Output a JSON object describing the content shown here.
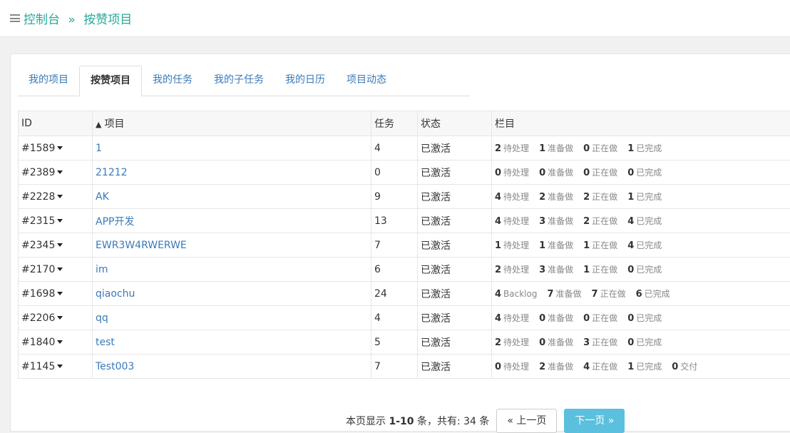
{
  "breadcrumb": {
    "home": "控制台",
    "separator": "»",
    "current": "按赞项目"
  },
  "tabs": [
    {
      "label": "我的项目",
      "active": false
    },
    {
      "label": "按赞项目",
      "active": true
    },
    {
      "label": "我的任务",
      "active": false
    },
    {
      "label": "我的子任务",
      "active": false
    },
    {
      "label": "我的日历",
      "active": false
    },
    {
      "label": "项目动态",
      "active": false
    }
  ],
  "table": {
    "headers": {
      "id": "ID",
      "sort_marker": "▲",
      "name": "项目",
      "tasks": "任务",
      "status": "状态",
      "lanes": "栏目"
    },
    "rows": [
      {
        "id": "#1589",
        "name": "1",
        "tasks": "4",
        "status": "已激活",
        "lanes": [
          {
            "n": "2",
            "l": "待处理"
          },
          {
            "n": "1",
            "l": "准备做"
          },
          {
            "n": "0",
            "l": "正在做"
          },
          {
            "n": "1",
            "l": "已完成"
          }
        ]
      },
      {
        "id": "#2389",
        "name": "21212",
        "tasks": "0",
        "status": "已激活",
        "lanes": [
          {
            "n": "0",
            "l": "待处理"
          },
          {
            "n": "0",
            "l": "准备做"
          },
          {
            "n": "0",
            "l": "正在做"
          },
          {
            "n": "0",
            "l": "已完成"
          }
        ]
      },
      {
        "id": "#2228",
        "name": "AK",
        "tasks": "9",
        "status": "已激活",
        "lanes": [
          {
            "n": "4",
            "l": "待处理"
          },
          {
            "n": "2",
            "l": "准备做"
          },
          {
            "n": "2",
            "l": "正在做"
          },
          {
            "n": "1",
            "l": "已完成"
          }
        ]
      },
      {
        "id": "#2315",
        "name": "APP开发",
        "tasks": "13",
        "status": "已激活",
        "lanes": [
          {
            "n": "4",
            "l": "待处理"
          },
          {
            "n": "3",
            "l": "准备做"
          },
          {
            "n": "2",
            "l": "正在做"
          },
          {
            "n": "4",
            "l": "已完成"
          }
        ]
      },
      {
        "id": "#2345",
        "name": "EWR3W4RWERWE",
        "tasks": "7",
        "status": "已激活",
        "lanes": [
          {
            "n": "1",
            "l": "待处理"
          },
          {
            "n": "1",
            "l": "准备做"
          },
          {
            "n": "1",
            "l": "正在做"
          },
          {
            "n": "4",
            "l": "已完成"
          }
        ]
      },
      {
        "id": "#2170",
        "name": "im",
        "tasks": "6",
        "status": "已激活",
        "lanes": [
          {
            "n": "2",
            "l": "待处理"
          },
          {
            "n": "3",
            "l": "准备做"
          },
          {
            "n": "1",
            "l": "正在做"
          },
          {
            "n": "0",
            "l": "已完成"
          }
        ]
      },
      {
        "id": "#1698",
        "name": "qiaochu",
        "tasks": "24",
        "status": "已激活",
        "lanes": [
          {
            "n": "4",
            "l": "Backlog"
          },
          {
            "n": "7",
            "l": "准备做"
          },
          {
            "n": "7",
            "l": "正在做"
          },
          {
            "n": "6",
            "l": "已完成"
          }
        ]
      },
      {
        "id": "#2206",
        "name": "qq",
        "tasks": "4",
        "status": "已激活",
        "lanes": [
          {
            "n": "4",
            "l": "待处理"
          },
          {
            "n": "0",
            "l": "准备做"
          },
          {
            "n": "0",
            "l": "正在做"
          },
          {
            "n": "0",
            "l": "已完成"
          }
        ]
      },
      {
        "id": "#1840",
        "name": "test",
        "tasks": "5",
        "status": "已激活",
        "lanes": [
          {
            "n": "2",
            "l": "待处理"
          },
          {
            "n": "0",
            "l": "准备做"
          },
          {
            "n": "3",
            "l": "正在做"
          },
          {
            "n": "0",
            "l": "已完成"
          }
        ]
      },
      {
        "id": "#1145",
        "name": "Test003",
        "tasks": "7",
        "status": "已激活",
        "lanes": [
          {
            "n": "0",
            "l": "待处理"
          },
          {
            "n": "2",
            "l": "准备做"
          },
          {
            "n": "4",
            "l": "正在做"
          },
          {
            "n": "1",
            "l": "已完成"
          },
          {
            "n": "0",
            "l": "交付"
          }
        ]
      }
    ]
  },
  "pager": {
    "summary_prefix": "本页显示",
    "range": "1-10",
    "summary_mid": "条，共有:",
    "total": "34",
    "summary_suffix": "条",
    "prev_label": "« 上一页",
    "next_label": "下一页 »"
  },
  "colors": {
    "brand": "#2aa89a",
    "link": "#3a7ab8",
    "next_button": "#5bc0de"
  }
}
